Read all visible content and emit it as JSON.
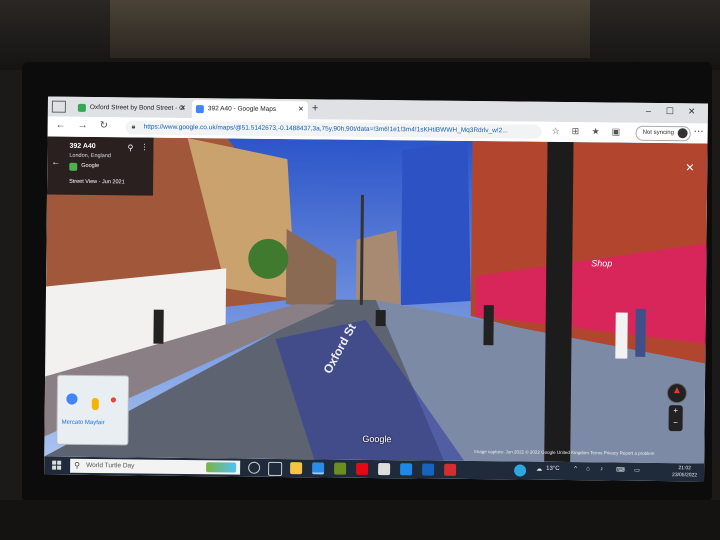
{
  "browser": {
    "tabs": [
      {
        "label": "Oxford Street by Bond Street - G",
        "active": false
      },
      {
        "label": "392 A40 - Google Maps",
        "active": true
      }
    ],
    "new_tab_symbol": "+",
    "url": "https://www.google.co.uk/maps/@51.5142673,-0.1488437,3a,75y,90h,90t/data=!3m6!1e1!3m4!1sKHtiBWWH_Mq3Rdrlv_w!2...",
    "sync_label": "Not syncing"
  },
  "street_view": {
    "address": "392 A40",
    "locality": "London, England",
    "source_label": "Google",
    "date_label": "Street View - Jun 2021",
    "minimap_place": "Mercato Mayfair",
    "road_marking": "Oxford St",
    "shop_sign": "Shop",
    "watermark": "Google",
    "attribution": "Image capture: Jun 2021  © 2022 Google  United Kingdom  Terms  Privacy  Report a problem"
  },
  "taskbar": {
    "search_placeholder": "World Turtle Day",
    "temperature": "13°C",
    "time": "21:02",
    "date": "23/05/2022"
  },
  "colors": {
    "sky": "#3b67d8",
    "storefront": "#d8265a",
    "taskbar": "#1f2a3a"
  }
}
